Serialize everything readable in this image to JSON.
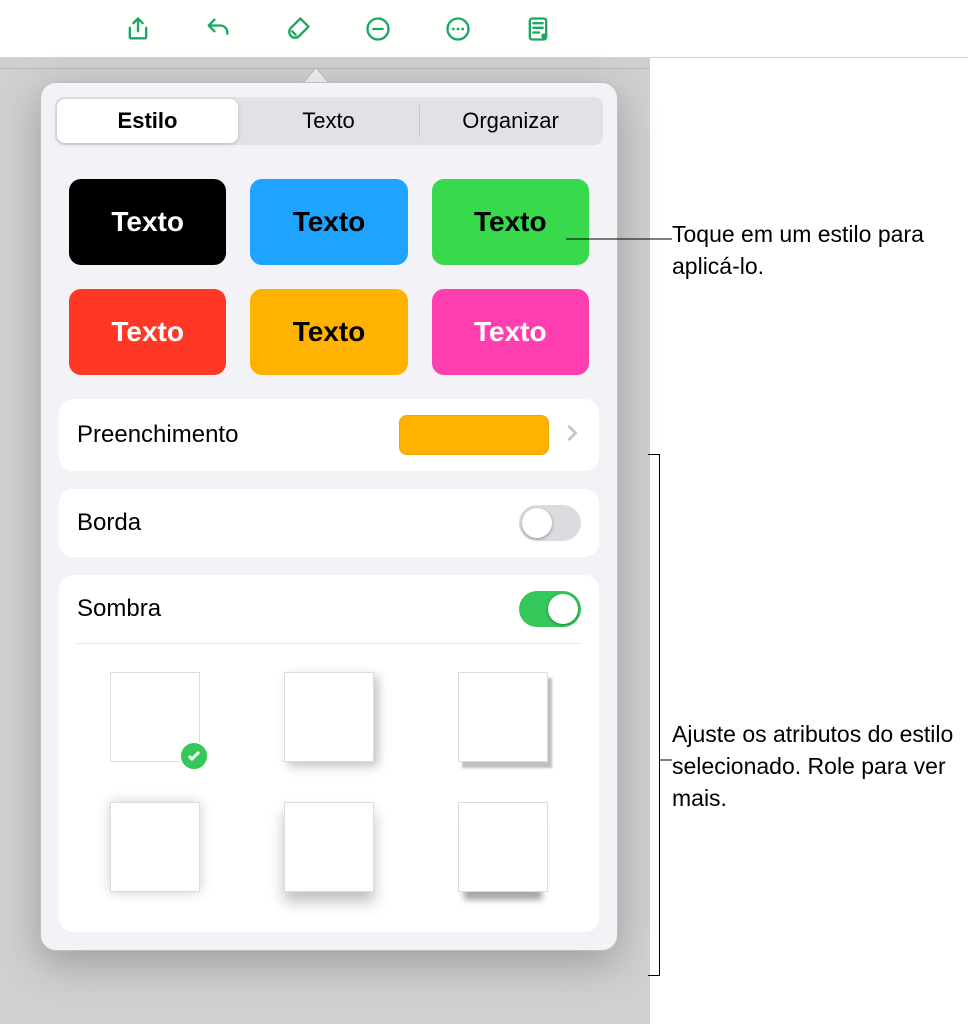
{
  "toolbar": {
    "icons": [
      "share",
      "undo",
      "format-brush",
      "comment",
      "more",
      "document-view"
    ]
  },
  "tabs": {
    "items": [
      "Estilo",
      "Texto",
      "Organizar"
    ],
    "active_index": 0
  },
  "style_swatches": {
    "label": "Texto"
  },
  "sections": {
    "fill": {
      "label": "Preenchimento",
      "color": "#ffb300"
    },
    "border": {
      "label": "Borda",
      "on": false
    },
    "shadow": {
      "label": "Sombra",
      "on": true,
      "selected_index": 0
    }
  },
  "callouts": {
    "tap_style": "Toque em um estilo para aplicá-lo.",
    "adjust": "Ajuste os atributos do estilo selecionado. Role para ver mais."
  }
}
